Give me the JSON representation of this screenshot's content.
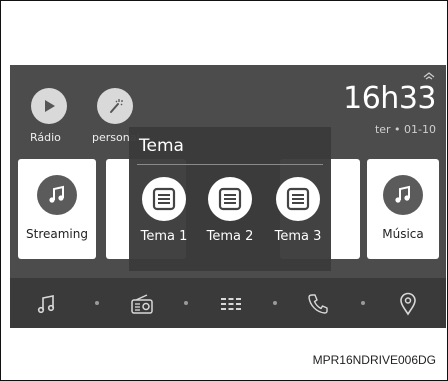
{
  "header": {
    "radio_label": "Rádio",
    "personal_label": "personal",
    "time": "16h33",
    "date": "ter • 01-10"
  },
  "tiles": [
    {
      "label": "Streaming",
      "icon": "music-note-icon"
    },
    {
      "label": "Música",
      "icon": "music-note-icon"
    }
  ],
  "popup": {
    "title": "Tema",
    "options": [
      {
        "label": "Tema 1",
        "icon": "theme-icon"
      },
      {
        "label": "Tema 2",
        "icon": "theme-icon"
      },
      {
        "label": "Tema 3",
        "icon": "theme-icon"
      }
    ]
  },
  "navbar": {
    "items": [
      "music-icon",
      "radio-icon",
      "apps-grid-icon",
      "phone-icon",
      "location-pin-icon"
    ]
  },
  "caption": "MPR16NDRIVE006DG",
  "colors": {
    "screen_bg": "#4c4c4c",
    "navbar_bg": "#3a3a3a",
    "popup_bg": "#3a3a3a",
    "tile_bg": "#ffffff"
  }
}
